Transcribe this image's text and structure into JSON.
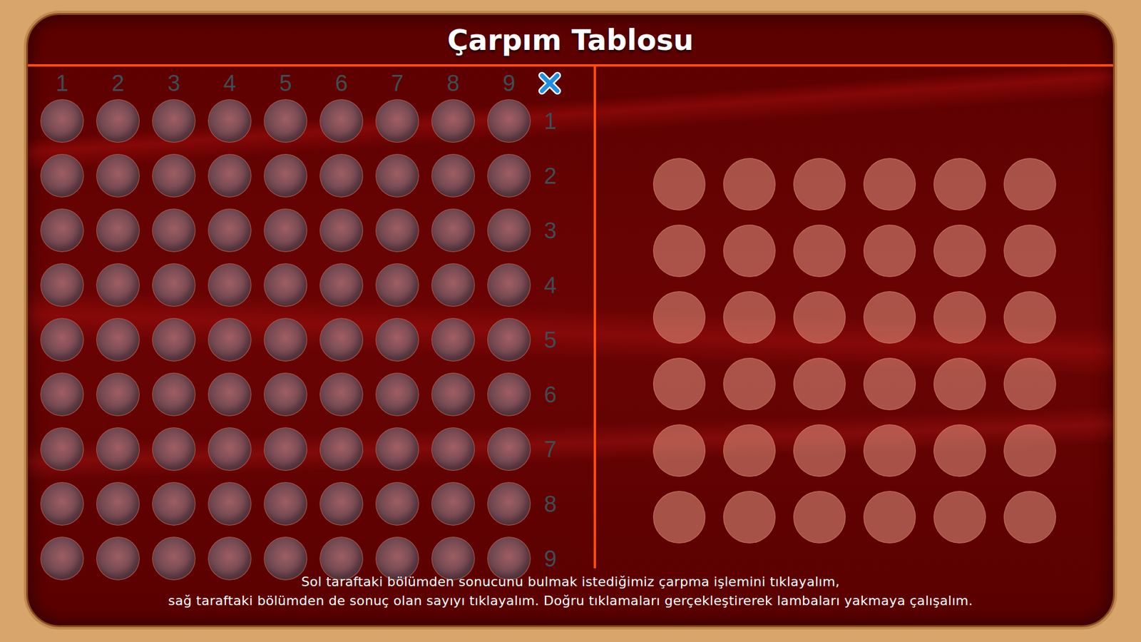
{
  "title": "Çarpım Tablosu",
  "columns": [
    "1",
    "2",
    "3",
    "4",
    "5",
    "6",
    "7",
    "8",
    "9"
  ],
  "rows": [
    {
      "label": "1",
      "lamps": [
        false,
        false,
        false,
        false,
        false,
        false,
        false,
        false,
        false
      ]
    },
    {
      "label": "2",
      "lamps": [
        false,
        false,
        false,
        false,
        false,
        false,
        false,
        false,
        false
      ]
    },
    {
      "label": "3",
      "lamps": [
        false,
        false,
        false,
        false,
        false,
        false,
        false,
        false,
        false
      ]
    },
    {
      "label": "4",
      "lamps": [
        false,
        false,
        false,
        false,
        false,
        false,
        false,
        false,
        false
      ]
    },
    {
      "label": "5",
      "lamps": [
        false,
        false,
        false,
        false,
        false,
        false,
        false,
        false,
        false
      ]
    },
    {
      "label": "6",
      "lamps": [
        false,
        false,
        false,
        false,
        false,
        false,
        false,
        false,
        false
      ]
    },
    {
      "label": "7",
      "lamps": [
        false,
        false,
        false,
        false,
        false,
        false,
        false,
        false,
        false
      ]
    },
    {
      "label": "8",
      "lamps": [
        false,
        false,
        false,
        false,
        false,
        false,
        false,
        false,
        false
      ]
    },
    {
      "label": "9",
      "lamps": [
        false,
        false,
        false,
        false,
        false,
        false,
        false,
        false,
        false
      ]
    }
  ],
  "answers": [
    [
      false,
      false,
      false,
      false,
      false,
      false
    ],
    [
      false,
      false,
      false,
      false,
      false,
      false
    ],
    [
      false,
      false,
      false,
      false,
      false,
      false
    ],
    [
      false,
      false,
      false,
      false,
      false,
      false
    ],
    [
      false,
      false,
      false,
      false,
      false,
      false
    ],
    [
      false,
      false,
      false,
      false,
      false,
      false
    ]
  ],
  "instructions": [
    "Sol taraftaki bölümden sonucunu bulmak istediğimiz çarpma işlemini tıklayalım,",
    "sağ taraftaki bölümden de sonuç olan sayıyı tıklayalım. Doğru tıklamaları gerçekleştirerek lambaları yakmaya çalışalım."
  ]
}
